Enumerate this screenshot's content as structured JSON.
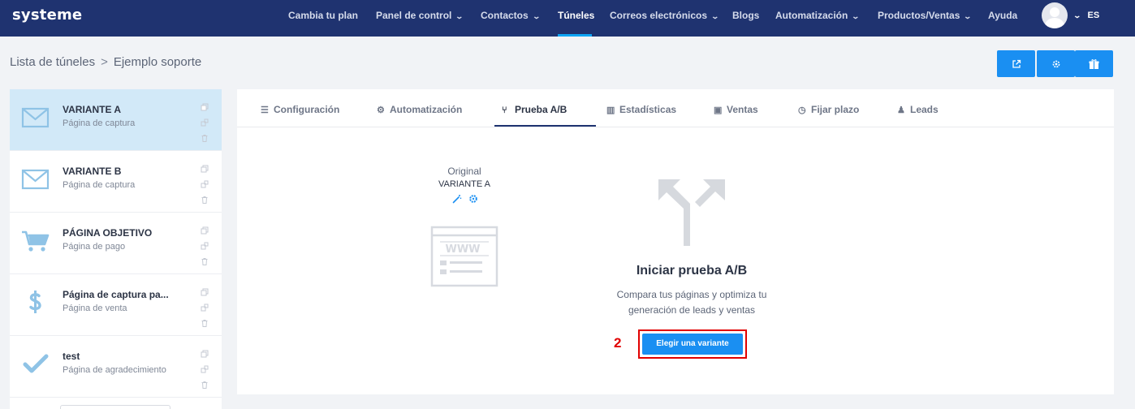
{
  "app": {
    "logo": "systeme"
  },
  "nav": {
    "items": [
      {
        "label": "Cambia tu plan",
        "dropdown": false,
        "active": false
      },
      {
        "label": "Panel de control",
        "dropdown": true,
        "active": false
      },
      {
        "label": "Contactos",
        "dropdown": true,
        "active": false
      },
      {
        "label": "Túneles",
        "dropdown": false,
        "active": true
      },
      {
        "label": "Correos electrónicos",
        "dropdown": true,
        "active": false
      },
      {
        "label": "Blogs",
        "dropdown": false,
        "active": false
      },
      {
        "label": "Automatización",
        "dropdown": true,
        "active": false
      },
      {
        "label": "Productos/Ventas",
        "dropdown": true,
        "active": false
      },
      {
        "label": "Ayuda",
        "dropdown": false,
        "active": false
      }
    ],
    "language": "ES",
    "chevron": "⌄"
  },
  "breadcrumb": {
    "parent": "Lista de túneles",
    "separator": ">",
    "current": "Ejemplo soporte"
  },
  "header_buttons": [
    {
      "icon": "external-link-icon"
    },
    {
      "icon": "gear-icon"
    },
    {
      "icon": "gift-icon"
    }
  ],
  "sidebar": {
    "steps": [
      {
        "title": "VARIANTE A",
        "subtitle": "Página de captura",
        "icon": "envelope-icon",
        "active": true
      },
      {
        "title": "VARIANTE B",
        "subtitle": "Página de captura",
        "icon": "envelope-icon",
        "active": false
      },
      {
        "title": "PÁGINA OBJETIVO",
        "subtitle": "Página de pago",
        "icon": "cart-icon",
        "active": false
      },
      {
        "title": "Página de captura pa...",
        "subtitle": "Página de venta",
        "icon": "dollar-icon",
        "active": false
      },
      {
        "title": "test",
        "subtitle": "Página de agradecimiento",
        "icon": "check-icon",
        "active": false
      }
    ]
  },
  "tabs": [
    {
      "label": "Configuración",
      "icon": "list-icon",
      "glyph": "☰",
      "active": false
    },
    {
      "label": "Automatización",
      "icon": "cogs-icon",
      "glyph": "⚙",
      "active": false
    },
    {
      "label": "Prueba A/B",
      "icon": "split-icon",
      "glyph": "⑂",
      "active": true
    },
    {
      "label": "Estadísticas",
      "icon": "bar-chart-icon",
      "glyph": "▥",
      "active": false
    },
    {
      "label": "Ventas",
      "icon": "money-icon",
      "glyph": "▣",
      "active": false
    },
    {
      "label": "Fijar plazo",
      "icon": "clock-icon",
      "glyph": "◷",
      "active": false
    },
    {
      "label": "Leads",
      "icon": "users-icon",
      "glyph": "♟",
      "active": false
    }
  ],
  "ab_test": {
    "original_label": "Original",
    "original_name": "VARIANTE A",
    "www_text": "WWW",
    "title": "Iniciar prueba A/B",
    "description": "Compara tus páginas y optimiza tu generación de leads y ventas",
    "marker": "2",
    "button_label": "Elegir una variante"
  },
  "colors": {
    "nav_bg": "#1f3370",
    "accent": "#1a8ff2",
    "active_step_bg": "#d2e9f8",
    "highlight": "#e10000"
  }
}
